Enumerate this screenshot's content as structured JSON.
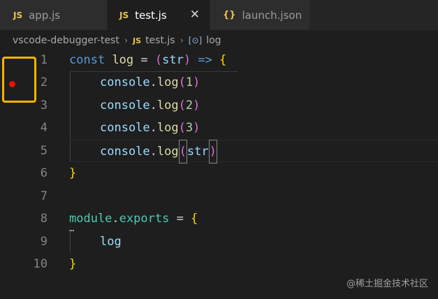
{
  "tabs": [
    {
      "icon": "JS",
      "label": "app.js",
      "active": false
    },
    {
      "icon": "JS",
      "label": "test.js",
      "active": true,
      "close": "✕"
    },
    {
      "icon": "{}",
      "label": "launch.json",
      "active": false
    }
  ],
  "breadcrumb": {
    "folder": "vscode-debugger-test",
    "file_icon": "JS",
    "file": "test.js",
    "symbol_icon": "[⊙]",
    "symbol": "log",
    "separator": "›"
  },
  "line_numbers": [
    "1",
    "2",
    "3",
    "4",
    "5",
    "6",
    "7",
    "8",
    "9",
    "10"
  ],
  "breakpoint": {
    "line": 2,
    "color": "#e51400",
    "highlight_color": "#f5b400"
  },
  "code": {
    "l1": {
      "const": "const",
      "log": "log",
      "eq": " = ",
      "paren_open": "(",
      "str": "str",
      "paren_close": ")",
      "arrow": " => ",
      "brace": "{"
    },
    "l2": {
      "obj": "console",
      "dot": ".",
      "fn": "log",
      "open": "(",
      "arg": "1",
      "close": ")"
    },
    "l3": {
      "obj": "console",
      "dot": ".",
      "fn": "log",
      "open": "(",
      "arg": "2",
      "close": ")"
    },
    "l4": {
      "obj": "console",
      "dot": ".",
      "fn": "log",
      "open": "(",
      "arg": "3",
      "close": ")"
    },
    "l5": {
      "obj": "console",
      "dot": ".",
      "fn": "log",
      "open": "(",
      "arg": "str",
      "close": ")"
    },
    "l6": {
      "brace": "}"
    },
    "l8": {
      "module": "module",
      "dot": ".",
      "exports": "exports",
      "eq": " = ",
      "brace": "{"
    },
    "l9": {
      "log": "log"
    },
    "l10": {
      "brace": "}"
    }
  },
  "ellipsis": "…",
  "watermark": "@稀土掘金技术社区"
}
